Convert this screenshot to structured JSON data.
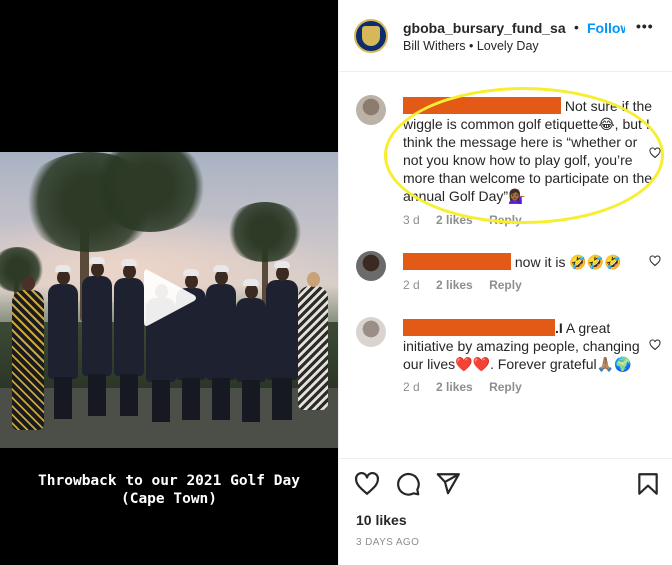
{
  "post": {
    "caption_line1": "Throwback to our 2021 Golf Day",
    "caption_line2": "(Cape Town)"
  },
  "header": {
    "username": "gboba_bursary_fund_sa",
    "separator": "•",
    "follow_label": "Follow",
    "more_label": "•••",
    "audio": "Bill Withers • Lovely Day"
  },
  "comments": [
    {
      "text_line1": "Not sure if the",
      "text_line2": "wiggle is common golf etiquette😂, but I think the message here is “whether or not you know how to play golf, you’re more than welcome to participate on the annual Golf Day”💁🏾‍♀️",
      "age": "3 d",
      "likes": "2 likes",
      "reply": "Reply"
    },
    {
      "text": " now it is 🤣🤣🤣",
      "age": "2 d",
      "likes": "2 likes",
      "reply": "Reply"
    },
    {
      "text_prefix": ".I",
      "text": " A great initiative by amazing people, changing our lives❤️❤️. Forever grateful🙏🏽🌍",
      "age": "2 d",
      "likes": "2 likes",
      "reply": "Reply"
    }
  ],
  "footer": {
    "likes": "10 likes",
    "date": "3 DAYS AGO"
  },
  "colors": {
    "follow": "#0095f6",
    "redaction": "#e35a16",
    "highlight": "#f6ee2e"
  },
  "icons": [
    "play-icon",
    "heart-icon",
    "comment-icon",
    "share-icon",
    "bookmark-icon",
    "small-heart-icon"
  ]
}
